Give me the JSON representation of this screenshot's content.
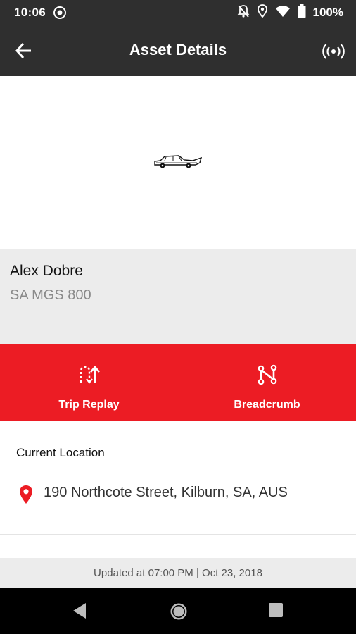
{
  "status_bar": {
    "time": "10:06",
    "battery": "100%",
    "icons": [
      "sync-icon",
      "bell-off-icon",
      "location-icon",
      "wifi-icon",
      "battery-icon"
    ]
  },
  "app_bar": {
    "title": "Asset Details",
    "back_icon": "arrow-back-icon",
    "right_icon": "broadcast-icon"
  },
  "asset": {
    "image_icon": "car-icon",
    "name": "Alex Dobre",
    "plate": "SA MGS 800"
  },
  "actions": [
    {
      "label": "Trip Replay",
      "icon": "trip-replay-icon"
    },
    {
      "label": "Breadcrumb",
      "icon": "breadcrumb-icon"
    }
  ],
  "location": {
    "section_title": "Current Location",
    "address": "190 Northcote Street, Kilburn, SA, AUS",
    "icon": "map-pin-icon"
  },
  "footer": {
    "updated_text": "Updated at 07:00 PM | Oct 23, 2018"
  },
  "colors": {
    "accent": "#ec1c24",
    "dark_bar": "#2f2f2f",
    "panel": "#ececec"
  }
}
